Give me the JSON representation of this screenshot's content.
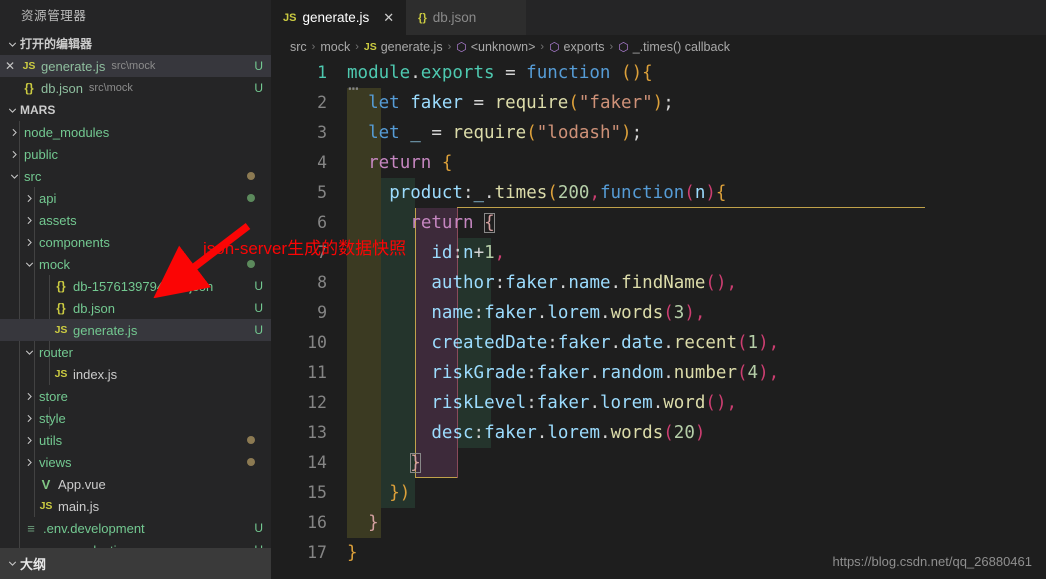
{
  "window": {
    "explorer_title": "资源管理器",
    "outline_title": "大纲"
  },
  "sidebar": {
    "open_editors": {
      "label": "打开的编辑器",
      "items": [
        {
          "icon": "js-file-icon",
          "icon_text": "JS",
          "name": "generate.js",
          "path": "src\\mock",
          "status": "U",
          "selected": true,
          "closable": true
        },
        {
          "icon": "json-file-icon",
          "icon_text": "{}",
          "name": "db.json",
          "path": "src\\mock",
          "status": "U",
          "selected": false,
          "closable": false
        }
      ]
    },
    "project": {
      "label": "MARS",
      "items": [
        {
          "depth": 1,
          "kind": "folder",
          "expanded": false,
          "name": "node_modules",
          "status": "",
          "dot": ""
        },
        {
          "depth": 1,
          "kind": "folder",
          "expanded": false,
          "name": "public",
          "status": "",
          "dot": ""
        },
        {
          "depth": 1,
          "kind": "folder",
          "expanded": true,
          "name": "src",
          "status": "",
          "dot": "modified"
        },
        {
          "depth": 2,
          "kind": "folder",
          "expanded": false,
          "name": "api",
          "status": "",
          "dot": "untracked"
        },
        {
          "depth": 2,
          "kind": "folder",
          "expanded": false,
          "name": "assets",
          "status": "",
          "dot": ""
        },
        {
          "depth": 2,
          "kind": "folder",
          "expanded": false,
          "name": "components",
          "status": "",
          "dot": ""
        },
        {
          "depth": 2,
          "kind": "folder",
          "expanded": true,
          "name": "mock",
          "status": "",
          "dot": "untracked"
        },
        {
          "depth": 3,
          "kind": "json",
          "icon_text": "{}",
          "name": "db-1576139794005.json",
          "status": "U",
          "dot": ""
        },
        {
          "depth": 3,
          "kind": "json",
          "icon_text": "{}",
          "name": "db.json",
          "status": "U",
          "dot": ""
        },
        {
          "depth": 3,
          "kind": "js",
          "icon_text": "JS",
          "name": "generate.js",
          "status": "U",
          "dot": "",
          "selected": true
        },
        {
          "depth": 2,
          "kind": "folder",
          "expanded": true,
          "name": "router",
          "status": "",
          "dot": ""
        },
        {
          "depth": 3,
          "kind": "js",
          "icon_text": "JS",
          "name": "index.js",
          "status": "",
          "dot": ""
        },
        {
          "depth": 2,
          "kind": "folder",
          "expanded": false,
          "name": "store",
          "status": "",
          "dot": ""
        },
        {
          "depth": 2,
          "kind": "folder",
          "expanded": false,
          "name": "style",
          "status": "",
          "dot": ""
        },
        {
          "depth": 2,
          "kind": "folder",
          "expanded": false,
          "name": "utils",
          "status": "",
          "dot": "modified"
        },
        {
          "depth": 2,
          "kind": "folder",
          "expanded": false,
          "name": "views",
          "status": "",
          "dot": "modified"
        },
        {
          "depth": 2,
          "kind": "vue",
          "icon_text": "V",
          "name": "App.vue",
          "status": "",
          "dot": ""
        },
        {
          "depth": 2,
          "kind": "js",
          "icon_text": "JS",
          "name": "main.js",
          "status": "",
          "dot": ""
        },
        {
          "depth": 1,
          "kind": "cfg",
          "icon_text": "≡",
          "name": ".env.development",
          "status": "U",
          "dot": ""
        },
        {
          "depth": 1,
          "kind": "cfg",
          "icon_text": "≡",
          "name": ".env.production",
          "status": "U",
          "dot": ""
        }
      ]
    }
  },
  "editor": {
    "tabs": [
      {
        "icon_text": "JS",
        "icon": "js-file-icon",
        "label": "generate.js",
        "active": true,
        "closable": true
      },
      {
        "icon_text": "{}",
        "icon": "json-file-icon",
        "label": "db.json",
        "active": false,
        "closable": false
      }
    ],
    "breadcrumb": [
      {
        "text": "src",
        "icon": ""
      },
      {
        "text": "mock",
        "icon": ""
      },
      {
        "text": "generate.js",
        "icon": "js-file-icon",
        "icon_text": "JS"
      },
      {
        "text": "<unknown>",
        "icon": "cube-icon",
        "icon_text": "⬡"
      },
      {
        "text": "exports",
        "icon": "cube-icon",
        "icon_text": "⬡"
      },
      {
        "text": "_.times() callback",
        "icon": "cube-icon",
        "icon_text": "⬡"
      }
    ],
    "breadcrumb_separator": "›",
    "line_numbers": [
      "1",
      "2",
      "3",
      "4",
      "5",
      "6",
      "7",
      "8",
      "9",
      "10",
      "11",
      "12",
      "13",
      "14",
      "15",
      "16",
      "17"
    ],
    "active_line": 1,
    "folding_ellipsis": "⋯",
    "code_lines": [
      {
        "n": 1,
        "indent": 0,
        "tokens": [
          {
            "t": "module",
            "c": "t-teal"
          },
          {
            "t": ".",
            "c": "t-white"
          },
          {
            "t": "exports",
            "c": "t-teal"
          },
          {
            "t": " ",
            "c": "t-white"
          },
          {
            "t": "=",
            "c": "t-white"
          },
          {
            "t": " ",
            "c": "t-white"
          },
          {
            "t": "function",
            "c": "t-blue"
          },
          {
            "t": " ",
            "c": "t-white"
          },
          {
            "t": "(",
            "c": "t-brk1"
          },
          {
            "t": ")",
            "c": "t-brk1"
          },
          {
            "t": "{",
            "c": "t-brk1"
          }
        ]
      },
      {
        "n": 2,
        "indent": 1,
        "tokens": [
          {
            "t": "let",
            "c": "t-blue"
          },
          {
            "t": " ",
            "c": "t-white"
          },
          {
            "t": "faker",
            "c": "t-lblue"
          },
          {
            "t": " ",
            "c": "t-white"
          },
          {
            "t": "=",
            "c": "t-white"
          },
          {
            "t": " ",
            "c": "t-white"
          },
          {
            "t": "require",
            "c": "t-yellow"
          },
          {
            "t": "(",
            "c": "t-brk1"
          },
          {
            "t": "\"faker\"",
            "c": "t-str"
          },
          {
            "t": ")",
            "c": "t-brk1"
          },
          {
            "t": ";",
            "c": "t-white"
          }
        ]
      },
      {
        "n": 3,
        "indent": 1,
        "tokens": [
          {
            "t": "let",
            "c": "t-blue"
          },
          {
            "t": " ",
            "c": "t-white"
          },
          {
            "t": "_",
            "c": "t-lblue"
          },
          {
            "t": " ",
            "c": "t-white"
          },
          {
            "t": "=",
            "c": "t-white"
          },
          {
            "t": " ",
            "c": "t-white"
          },
          {
            "t": "require",
            "c": "t-yellow"
          },
          {
            "t": "(",
            "c": "t-brk1"
          },
          {
            "t": "\"lodash\"",
            "c": "t-str"
          },
          {
            "t": ")",
            "c": "t-brk1"
          },
          {
            "t": ";",
            "c": "t-white"
          }
        ]
      },
      {
        "n": 4,
        "indent": 1,
        "tokens": [
          {
            "t": "return",
            "c": "t-pink"
          },
          {
            "t": " ",
            "c": "t-white"
          },
          {
            "t": "{",
            "c": "t-brk1"
          }
        ]
      },
      {
        "n": 5,
        "indent": 2,
        "tokens": [
          {
            "t": "product",
            "c": "t-lblue"
          },
          {
            "t": ":",
            "c": "t-white"
          },
          {
            "t": "_",
            "c": "t-lblue"
          },
          {
            "t": ".",
            "c": "t-white"
          },
          {
            "t": "times",
            "c": "t-yellow"
          },
          {
            "t": "(",
            "c": "t-brk1"
          },
          {
            "t": "200",
            "c": "t-num"
          },
          {
            "t": ",",
            "c": "t-mag"
          },
          {
            "t": "function",
            "c": "t-blue"
          },
          {
            "t": "(",
            "c": "t-brk2"
          },
          {
            "t": "n",
            "c": "t-lblue"
          },
          {
            "t": ")",
            "c": "t-brk2"
          },
          {
            "t": "{",
            "c": "t-brk1"
          }
        ]
      },
      {
        "n": 6,
        "indent": 3,
        "tokens": [
          {
            "t": "return",
            "c": "t-pink"
          },
          {
            "t": " ",
            "c": "t-white"
          },
          {
            "t": "{",
            "c": "t-brk3",
            "match": true
          }
        ]
      },
      {
        "n": 7,
        "indent": 4,
        "tokens": [
          {
            "t": "id",
            "c": "t-lblue"
          },
          {
            "t": ":",
            "c": "t-white"
          },
          {
            "t": "n",
            "c": "t-lblue"
          },
          {
            "t": "+",
            "c": "t-white"
          },
          {
            "t": "1",
            "c": "t-num"
          },
          {
            "t": ",",
            "c": "t-mag"
          }
        ]
      },
      {
        "n": 8,
        "indent": 4,
        "tokens": [
          {
            "t": "author",
            "c": "t-lblue"
          },
          {
            "t": ":",
            "c": "t-white"
          },
          {
            "t": "faker",
            "c": "t-lblue"
          },
          {
            "t": ".",
            "c": "t-white"
          },
          {
            "t": "name",
            "c": "t-lblue"
          },
          {
            "t": ".",
            "c": "t-white"
          },
          {
            "t": "findName",
            "c": "t-yellow"
          },
          {
            "t": "(",
            "c": "t-brk2"
          },
          {
            "t": ")",
            "c": "t-brk2"
          },
          {
            "t": ",",
            "c": "t-mag"
          }
        ]
      },
      {
        "n": 9,
        "indent": 4,
        "tokens": [
          {
            "t": "name",
            "c": "t-lblue"
          },
          {
            "t": ":",
            "c": "t-white"
          },
          {
            "t": "faker",
            "c": "t-lblue"
          },
          {
            "t": ".",
            "c": "t-white"
          },
          {
            "t": "lorem",
            "c": "t-lblue"
          },
          {
            "t": ".",
            "c": "t-white"
          },
          {
            "t": "words",
            "c": "t-yellow"
          },
          {
            "t": "(",
            "c": "t-brk2"
          },
          {
            "t": "3",
            "c": "t-num"
          },
          {
            "t": ")",
            "c": "t-brk2"
          },
          {
            "t": ",",
            "c": "t-mag"
          }
        ]
      },
      {
        "n": 10,
        "indent": 4,
        "tokens": [
          {
            "t": "createdDate",
            "c": "t-lblue"
          },
          {
            "t": ":",
            "c": "t-white"
          },
          {
            "t": "faker",
            "c": "t-lblue"
          },
          {
            "t": ".",
            "c": "t-white"
          },
          {
            "t": "date",
            "c": "t-lblue"
          },
          {
            "t": ".",
            "c": "t-white"
          },
          {
            "t": "recent",
            "c": "t-yellow"
          },
          {
            "t": "(",
            "c": "t-brk2"
          },
          {
            "t": "1",
            "c": "t-num"
          },
          {
            "t": ")",
            "c": "t-brk2"
          },
          {
            "t": ",",
            "c": "t-mag"
          }
        ]
      },
      {
        "n": 11,
        "indent": 4,
        "tokens": [
          {
            "t": "riskGrade",
            "c": "t-lblue"
          },
          {
            "t": ":",
            "c": "t-white"
          },
          {
            "t": "faker",
            "c": "t-lblue"
          },
          {
            "t": ".",
            "c": "t-white"
          },
          {
            "t": "random",
            "c": "t-lblue"
          },
          {
            "t": ".",
            "c": "t-white"
          },
          {
            "t": "number",
            "c": "t-yellow"
          },
          {
            "t": "(",
            "c": "t-brk2"
          },
          {
            "t": "4",
            "c": "t-num"
          },
          {
            "t": ")",
            "c": "t-brk2"
          },
          {
            "t": ",",
            "c": "t-mag"
          }
        ]
      },
      {
        "n": 12,
        "indent": 4,
        "tokens": [
          {
            "t": "riskLevel",
            "c": "t-lblue"
          },
          {
            "t": ":",
            "c": "t-white"
          },
          {
            "t": "faker",
            "c": "t-lblue"
          },
          {
            "t": ".",
            "c": "t-white"
          },
          {
            "t": "lorem",
            "c": "t-lblue"
          },
          {
            "t": ".",
            "c": "t-white"
          },
          {
            "t": "word",
            "c": "t-yellow"
          },
          {
            "t": "(",
            "c": "t-brk2"
          },
          {
            "t": ")",
            "c": "t-brk2"
          },
          {
            "t": ",",
            "c": "t-mag"
          }
        ]
      },
      {
        "n": 13,
        "indent": 4,
        "tokens": [
          {
            "t": "desc",
            "c": "t-lblue"
          },
          {
            "t": ":",
            "c": "t-white"
          },
          {
            "t": "faker",
            "c": "t-lblue"
          },
          {
            "t": ".",
            "c": "t-white"
          },
          {
            "t": "lorem",
            "c": "t-lblue"
          },
          {
            "t": ".",
            "c": "t-white"
          },
          {
            "t": "words",
            "c": "t-yellow"
          },
          {
            "t": "(",
            "c": "t-brk2"
          },
          {
            "t": "20",
            "c": "t-num"
          },
          {
            "t": ")",
            "c": "t-brk2"
          }
        ]
      },
      {
        "n": 14,
        "indent": 3,
        "tokens": [
          {
            "t": "}",
            "c": "t-brk3",
            "match": true
          }
        ]
      },
      {
        "n": 15,
        "indent": 2,
        "tokens": [
          {
            "t": "}",
            "c": "t-brk1"
          },
          {
            "t": ")",
            "c": "t-brk1"
          }
        ]
      },
      {
        "n": 16,
        "indent": 1,
        "tokens": [
          {
            "t": "}",
            "c": "t-brk3"
          }
        ]
      },
      {
        "n": 17,
        "indent": 0,
        "tokens": [
          {
            "t": "}",
            "c": "t-brk1"
          }
        ]
      }
    ]
  },
  "annotations": {
    "note_text": "json-server生成的数据快照",
    "note_color": "#fb0505",
    "arrow_color": "#fb0505",
    "watermark": "https://blog.csdn.net/qq_26880461"
  }
}
